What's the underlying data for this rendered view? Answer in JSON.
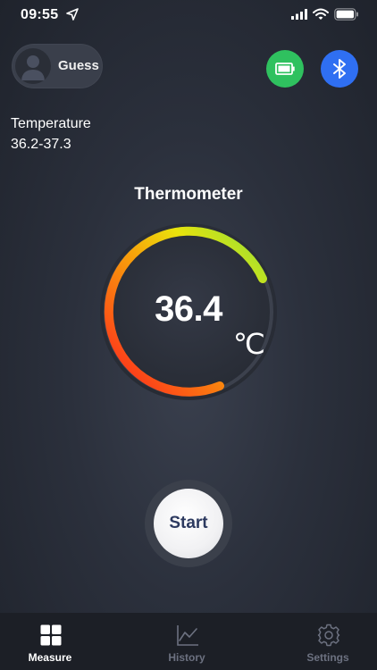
{
  "status_bar": {
    "time": "09:55",
    "icons": [
      "location-arrow-icon",
      "signal-icon",
      "wifi-icon",
      "battery-icon"
    ]
  },
  "user": {
    "name": "Guess",
    "avatar_icon": "person-icon"
  },
  "header_buttons": {
    "battery": {
      "icon": "battery-icon",
      "color": "#2fc15f"
    },
    "bluetooth": {
      "icon": "bluetooth-icon",
      "color": "#2f6ff2"
    }
  },
  "temperature_info": {
    "label": "Temperature",
    "range": "36.2-37.3"
  },
  "title": "Thermometer",
  "gauge": {
    "value": "36.4",
    "unit": "℃",
    "gradient_colors": [
      "#ff1f1f",
      "#f7e20a",
      "#8ee03a"
    ]
  },
  "start_button": {
    "label": "Start"
  },
  "tabs": [
    {
      "label": "Measure",
      "icon": "grid-icon",
      "active": true
    },
    {
      "label": "History",
      "icon": "chart-line-icon",
      "active": false
    },
    {
      "label": "Settings",
      "icon": "gear-icon",
      "active": false
    }
  ],
  "colors": {
    "active_tab": "#ffffff",
    "inactive_tab": "#6c7180",
    "start_text": "#2d3a60"
  }
}
